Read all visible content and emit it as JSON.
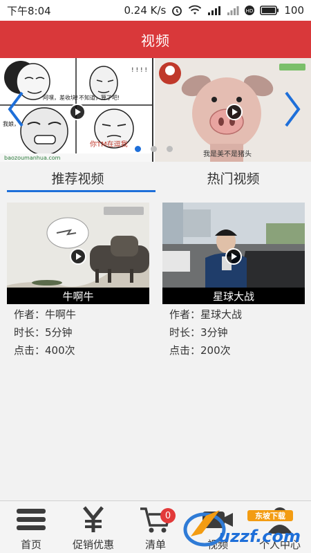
{
  "status_bar": {
    "time": "下午8:04",
    "speed": "0.24 K/s",
    "battery": "100"
  },
  "header": {
    "title": "视频"
  },
  "banner": {
    "left": {
      "speech_1": "阿嘿，差收块!",
      "speech_2": "不知道，算了吧!",
      "speech_3": "我娘，",
      "speech_4": "你TM在逗我",
      "bottom_text": "baozoumanhua.com"
    },
    "right": {
      "caption": "我是美不是猪头"
    },
    "dots": 3,
    "active_dot": 0
  },
  "tabs": [
    {
      "label": "推荐视频",
      "active": true
    },
    {
      "label": "热门视频",
      "active": false
    }
  ],
  "videos": [
    {
      "title": "牛啊牛",
      "author_label": "作者：",
      "author": "牛啊牛",
      "duration_label": "时长：",
      "duration": "5分钟",
      "clicks_label": "点击：",
      "clicks": "400次"
    },
    {
      "title": "星球大战",
      "author_label": "作者：",
      "author": "星球大战",
      "duration_label": "时长：",
      "duration": "3分钟",
      "clicks_label": "点击：",
      "clicks": "200次"
    }
  ],
  "bottom_nav": [
    {
      "label": "首页",
      "icon": "menu-icon"
    },
    {
      "label": "促销优惠",
      "icon": "yen-icon"
    },
    {
      "label": "清单",
      "icon": "cart-icon",
      "badge": "0"
    },
    {
      "label": "视频",
      "icon": "video-icon"
    },
    {
      "label": "个人中心",
      "icon": "user-icon"
    }
  ],
  "watermark": {
    "text": "uzzf.com",
    "small": "东坡下载"
  },
  "colors": {
    "brand_red": "#d9383a",
    "accent_blue": "#1e6fd9"
  }
}
